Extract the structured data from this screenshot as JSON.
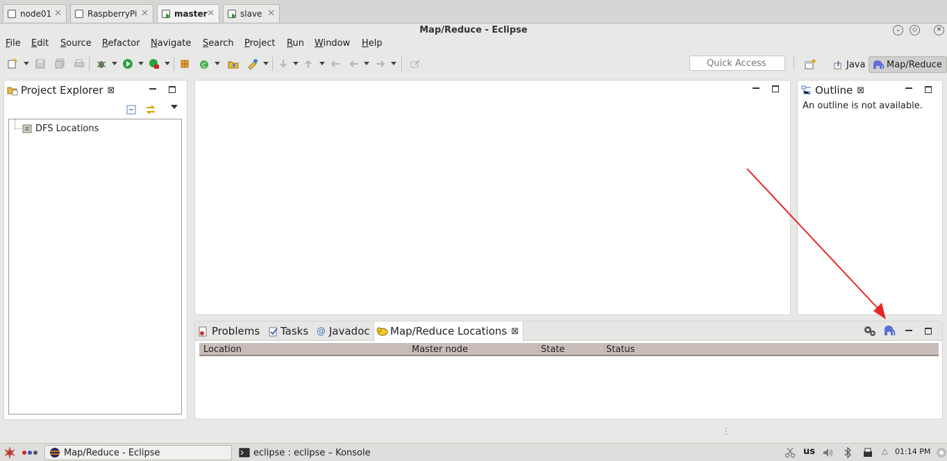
{
  "vnc_tabs": [
    {
      "label": "node01",
      "active": false
    },
    {
      "label": "RaspberryPi",
      "active": false
    },
    {
      "label": "master",
      "active": true
    },
    {
      "label": "slave",
      "active": false
    }
  ],
  "window": {
    "title": "Map/Reduce - Eclipse"
  },
  "menu": [
    "File",
    "Edit",
    "Source",
    "Refactor",
    "Navigate",
    "Search",
    "Project",
    "Run",
    "Window",
    "Help"
  ],
  "toolbar": {
    "quick_access_placeholder": "Quick Access",
    "perspectives": [
      {
        "label": "Java",
        "icon": "java-perspective-icon",
        "active": false
      },
      {
        "label": "Map/Reduce",
        "icon": "elephant-icon",
        "active": true
      }
    ]
  },
  "project_explorer": {
    "title": "Project Explorer",
    "tree": [
      {
        "label": "DFS Locations",
        "icon": "database-folder-icon"
      }
    ]
  },
  "outline": {
    "title": "Outline",
    "message": "An outline is not available."
  },
  "bottom_panel": {
    "tabs": [
      {
        "label": "Problems",
        "icon": "problems-icon"
      },
      {
        "label": "Tasks",
        "icon": "tasks-icon"
      },
      {
        "label": "Javadoc",
        "icon": "at-icon"
      },
      {
        "label": "Map/Reduce Locations",
        "icon": "mapreduce-location-icon",
        "active": true
      }
    ],
    "columns": [
      "Location",
      "Master node",
      "State",
      "Status"
    ],
    "rows": []
  },
  "taskbar": {
    "tasks": [
      {
        "label": "Map/Reduce - Eclipse",
        "active": true
      },
      {
        "label": "eclipse : eclipse – Konsole",
        "active": false
      }
    ],
    "keyboard_layout": "us",
    "clock": "01:14 PM"
  },
  "colors": {
    "annotation_arrow": "#e8262a",
    "selection_header": "#c9bdb9",
    "accent_green": "#27a33b"
  }
}
